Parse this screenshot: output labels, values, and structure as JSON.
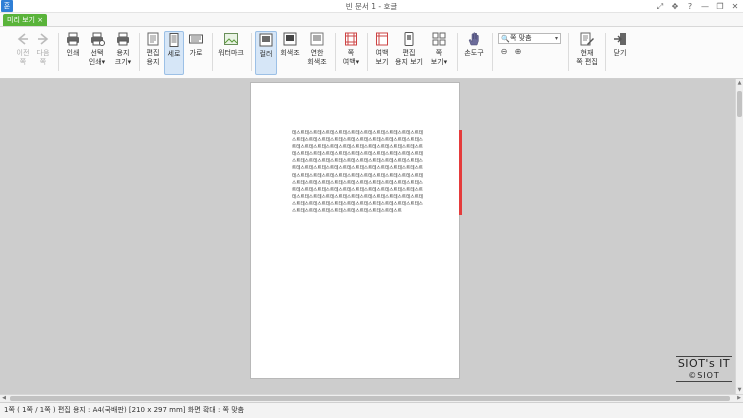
{
  "window": {
    "app_icon_label": "훈",
    "title": "빈 문서 1 - 호글",
    "controls": [
      "⤢",
      "✥",
      "?",
      "—",
      "❐",
      "✕"
    ]
  },
  "tab": {
    "label": "미리 보기 ×"
  },
  "toolbar": {
    "prev": "이전\n쪽",
    "next": "다음\n쪽",
    "print": "인쇄",
    "select_print": "선택\n인쇄▾",
    "paper_size": "용지\n크기▾",
    "edit_paper": "편집\n용지",
    "portrait": "세로",
    "landscape": "가로",
    "watermark": "워터마크",
    "color": "컬러",
    "grayscale": "회색조",
    "light_grayscale": "연한\n회색조",
    "page_margin": "쪽\n여백▾",
    "margin_view": "여백\n보기",
    "edit_paper_view": "편집\n용지 보기",
    "page_view": "쪽\n보기▾",
    "hand_tool": "손도구",
    "zoom_value": "쪽 맞춤",
    "current_page_edit": "현재\n쪽 편집",
    "close": "닫기"
  },
  "document": {
    "lines": [
      "테스트테스트테스트테스트테스트테스트테스트테스트테스트테스트테",
      "스트테스트테스트테스트테스트테스트테스트테스트테스트테스트테스",
      "트테스트테스트테스트테스트테스트테스트테스트테스트테스트테스트",
      "테스트테스트테스트테스트테스트테스트테스트테스트테스트테스트테",
      "스트테스트테스트테스트테스트테스트테스트테스트테스트테스트테스",
      "트테스트테스트테스트테스트테스트테스트테스트테스트테스트테스트",
      "테스트테스트테스트테스트테스트테스트테스트테스트테스트테스트테",
      "스트테스트테스트테스트테스트테스트테스트테스트테스트테스트테스",
      "트테스트테스트테스트테스트테스트테스트테스트테스트테스트테스트",
      "테스트테스트테스트테스트테스트테스트테스트테스트테스트테스트테",
      "스트테스트테스트테스트테스트테스트테스트테스트테스트테스트테스",
      "스트테스트테스트테스트테스트테스트테스트테스트테스트"
    ]
  },
  "status": {
    "text": "1쪽 ( 1쪽 / 1쪽 )  편집 용지 : A4(국배판)  [210 x 297 mm]  화면 확대 : 쪽 맞춤"
  },
  "watermark": {
    "line1": "SIOT's IT",
    "line2": "©SIOT"
  },
  "colors": {
    "accent_tab": "#59b33a",
    "selection": "#d6e6f7",
    "red_mark": "#e53b3b"
  }
}
